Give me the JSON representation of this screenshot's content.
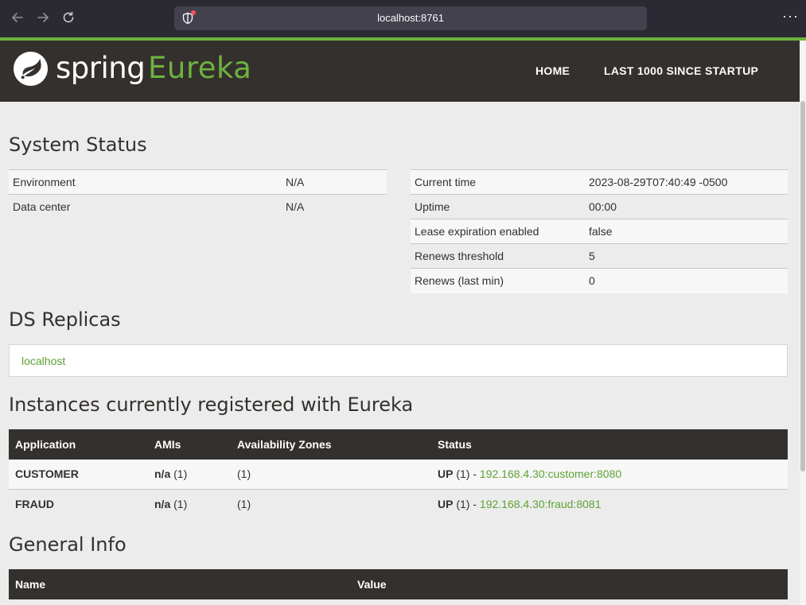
{
  "browser": {
    "url": "localhost:8761",
    "back_icon": "arrow-left-icon",
    "forward_icon": "arrow-right-icon",
    "reload_icon": "reload-icon",
    "menu_icon": "more-horizontal-icon"
  },
  "header": {
    "logo_spring": "spring",
    "logo_eureka": "Eureka",
    "nav": [
      "HOME",
      "LAST 1000 SINCE STARTUP"
    ]
  },
  "system_status": {
    "title": "System Status",
    "left": [
      {
        "label": "Environment",
        "value": "N/A"
      },
      {
        "label": "Data center",
        "value": "N/A"
      }
    ],
    "right": [
      {
        "label": "Current time",
        "value": "2023-08-29T07:40:49 -0500"
      },
      {
        "label": "Uptime",
        "value": "00:00"
      },
      {
        "label": "Lease expiration enabled",
        "value": "false"
      },
      {
        "label": "Renews threshold",
        "value": "5"
      },
      {
        "label": "Renews (last min)",
        "value": "0"
      }
    ]
  },
  "ds_replicas": {
    "title": "DS Replicas",
    "items": [
      "localhost"
    ]
  },
  "instances": {
    "title": "Instances currently registered with Eureka",
    "headers": [
      "Application",
      "AMIs",
      "Availability Zones",
      "Status"
    ],
    "rows": [
      {
        "application": "CUSTOMER",
        "ami_bold": "n/a",
        "ami_count": " (1)",
        "zones": "(1)",
        "status_bold": "UP",
        "status_count": " (1) - ",
        "status_link": "192.168.4.30:customer:8080"
      },
      {
        "application": "FRAUD",
        "ami_bold": "n/a",
        "ami_count": " (1)",
        "zones": "(1)",
        "status_bold": "UP",
        "status_count": " (1) - ",
        "status_link": "192.168.4.30:fraud:8081"
      }
    ]
  },
  "general_info": {
    "title": "General Info",
    "headers": [
      "Name",
      "Value"
    ]
  },
  "colors": {
    "brand_green": "#6db33f",
    "header_dark": "#34302d",
    "link_green": "#5fa134"
  }
}
